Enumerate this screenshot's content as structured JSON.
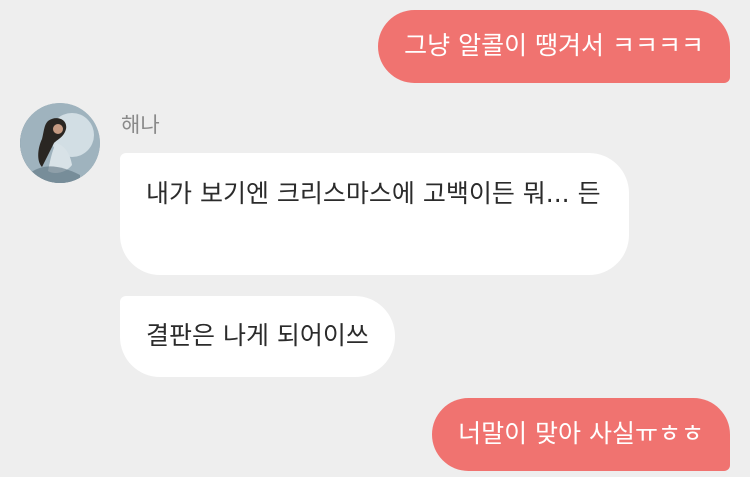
{
  "thread": {
    "messages": [
      {
        "direction": "outgoing",
        "text": "그냥 알콜이 땡겨서 ㅋㅋㅋㅋ"
      },
      {
        "direction": "incoming",
        "sender": "해나",
        "text": "내가 보기엔 크리스마스에 고백이든 뭐... 든"
      },
      {
        "direction": "incoming",
        "sender": "해나",
        "text": "결판은 나게 되어이쓰"
      },
      {
        "direction": "outgoing",
        "text": "너말이 맞아 사실ㅠㅎㅎ"
      }
    ]
  },
  "contact": {
    "name": "해나",
    "avatar_icon": "profile-photo-avatar"
  },
  "colors": {
    "background": "#eeeeee",
    "outgoing_bubble": "#f07370",
    "incoming_bubble": "#ffffff",
    "sender_name": "#8a8a8a"
  }
}
